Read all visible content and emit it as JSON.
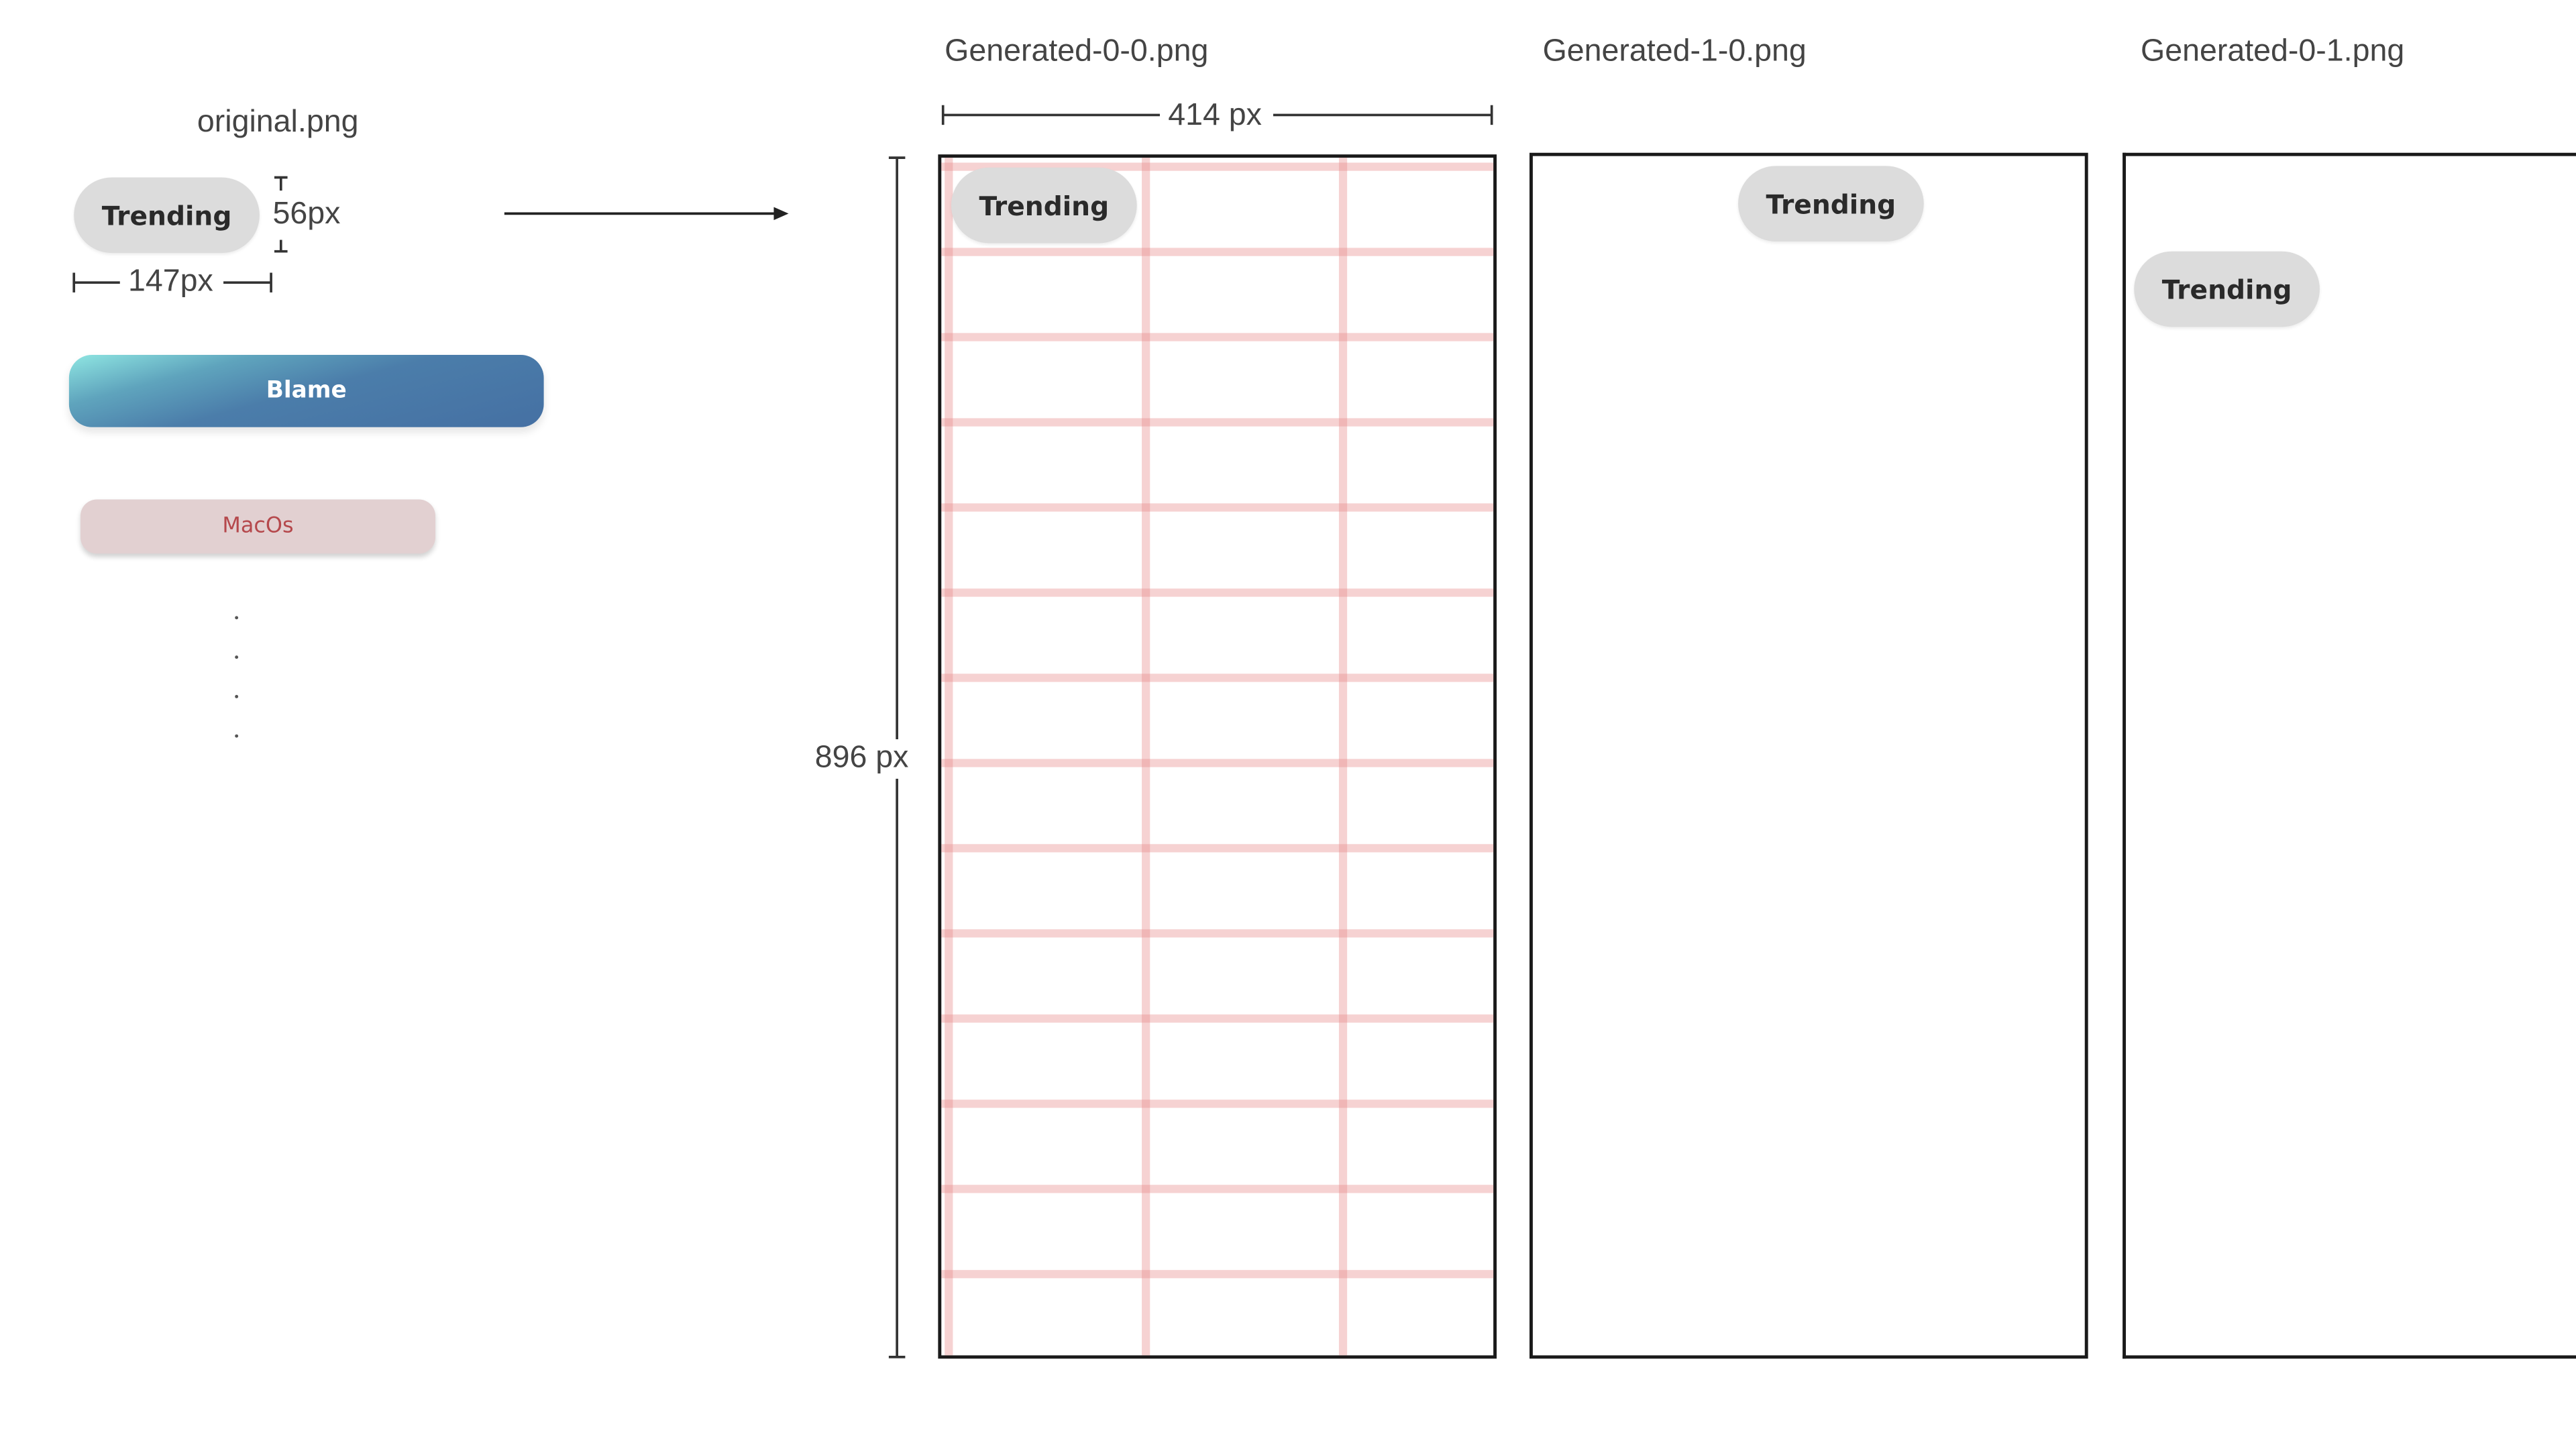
{
  "original": {
    "title": "original.png",
    "trending_label": "Trending",
    "height_label": "56px",
    "width_label": "147px",
    "blame_label": "Blame",
    "macos_label": "MacOs"
  },
  "generated": [
    {
      "title": "Generated-0-0.png",
      "pill_label": "Trending",
      "width_label": "414 px",
      "height_label": "896 px"
    },
    {
      "title": "Generated-1-0.png",
      "pill_label": "Trending"
    },
    {
      "title": "Generated-0-1.png",
      "pill_label": "Trending"
    }
  ],
  "colors": {
    "pill_bg": "#dcdcdc",
    "grid_red": "#e88a8a",
    "blame_gradient_start": "#8fe6e2",
    "blame_gradient_end": "#4570a3",
    "macos_bg": "#e2d0d1",
    "macos_text": "#b5484c",
    "frame_border": "#1a1a1a"
  },
  "grid": {
    "rows": 14,
    "columns": 3
  }
}
